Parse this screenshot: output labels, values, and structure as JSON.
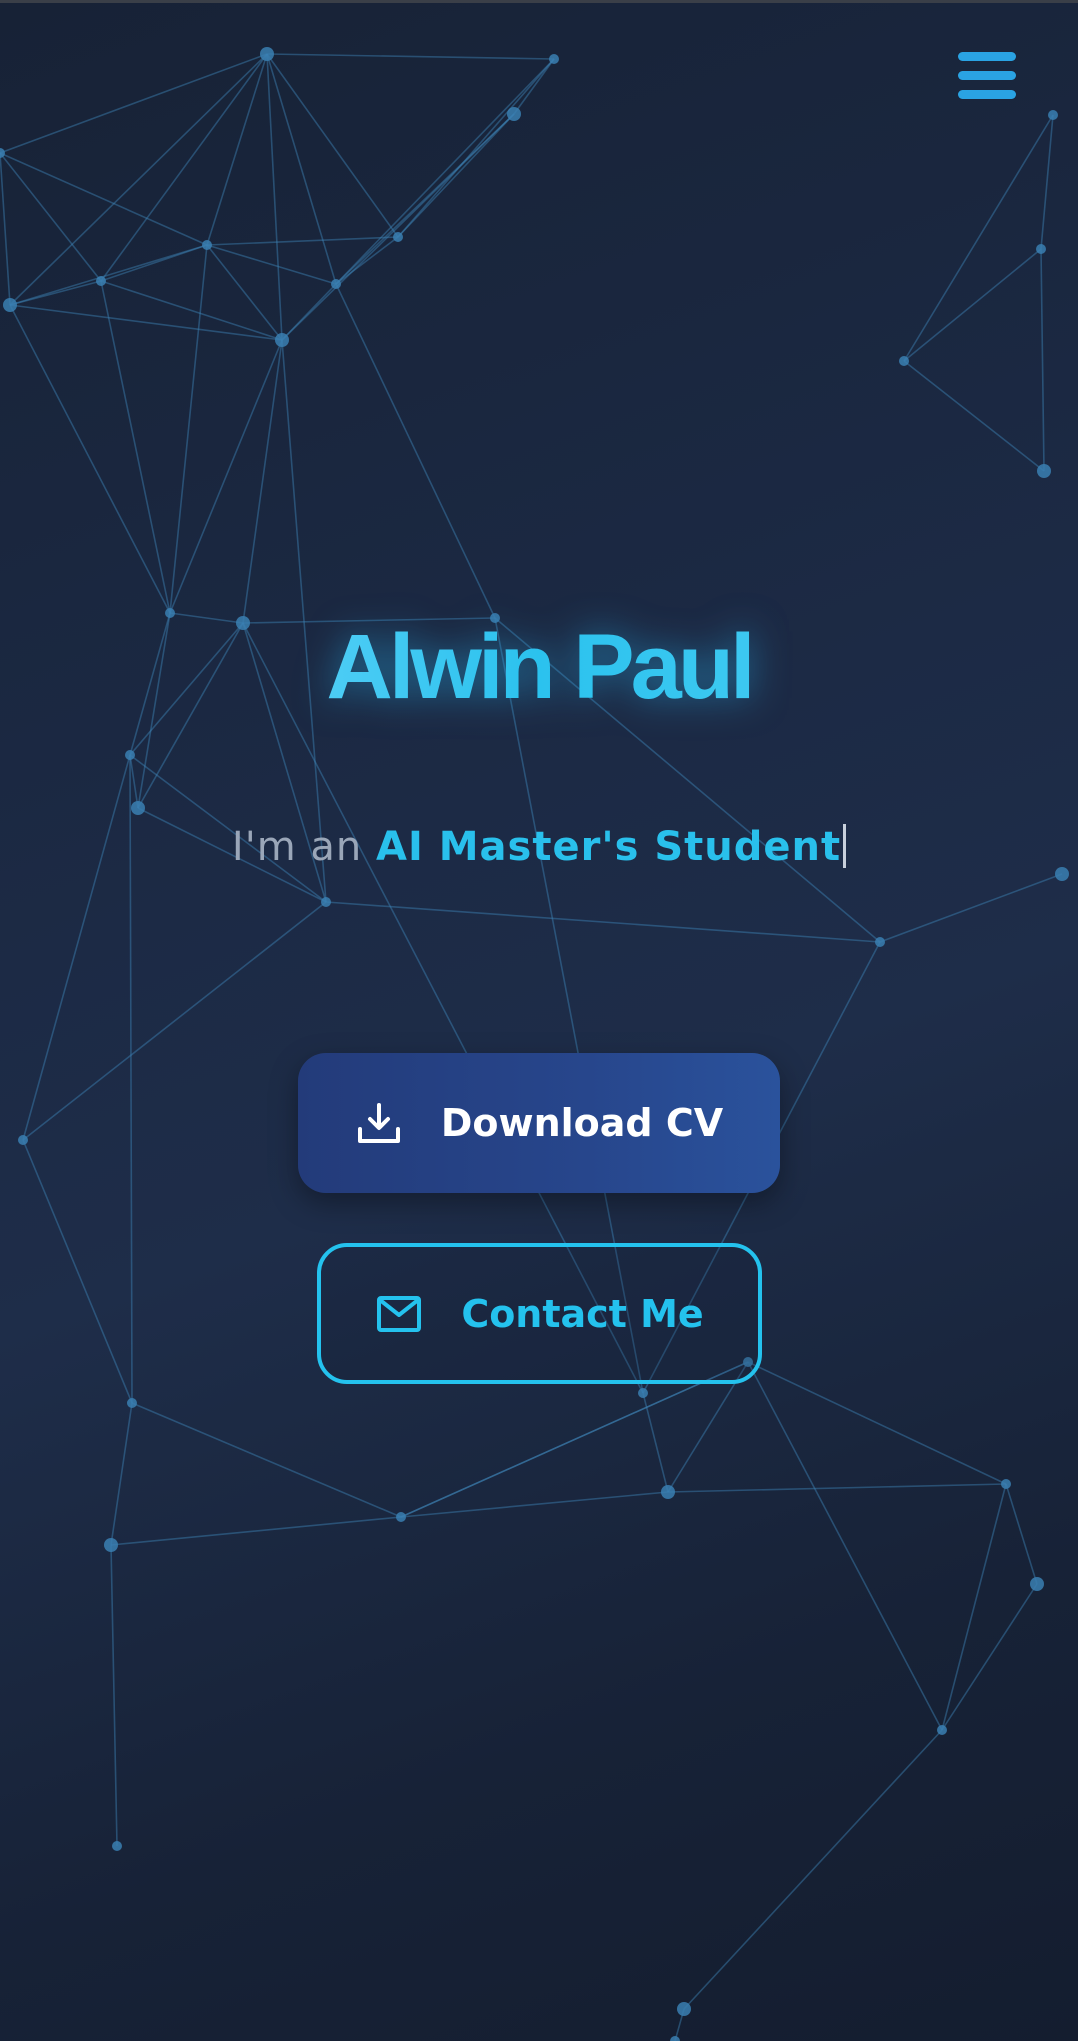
{
  "header": {
    "menu_icon": "hamburger-menu-icon"
  },
  "hero": {
    "name": "Alwin Paul",
    "tagline_prefix": "I'm an ",
    "tagline_role": "AI Master's Student"
  },
  "buttons": {
    "download": {
      "label": "Download CV",
      "icon": "download-icon"
    },
    "contact": {
      "label": "Contact Me",
      "icon": "mail-icon"
    }
  },
  "colors": {
    "background": "#1c2a45",
    "accent": "#24c2ee",
    "primary_button": "#27468c",
    "network_line": "#3f86b8",
    "network_node": "#3a7fb2"
  }
}
